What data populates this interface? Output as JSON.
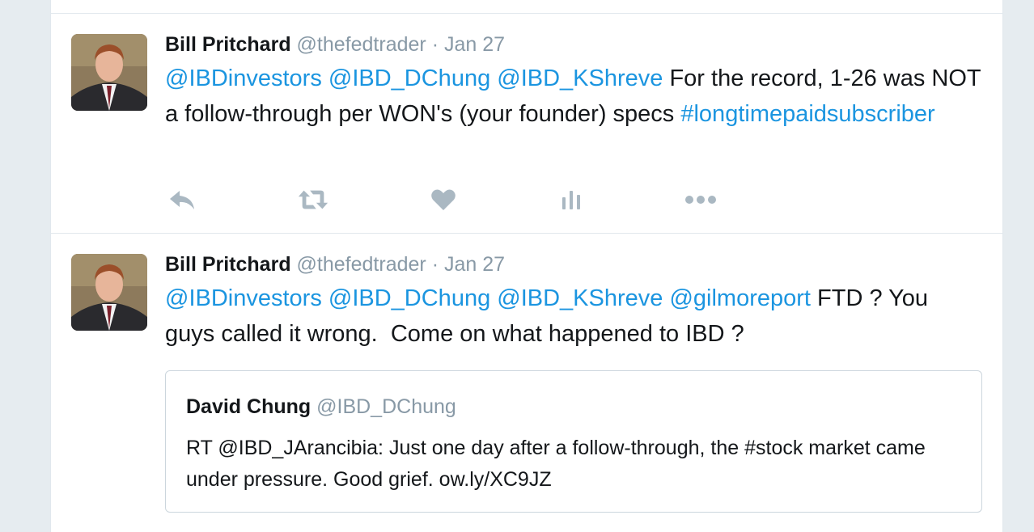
{
  "tweets": [
    {
      "author_name": "Bill Pritchard",
      "screen_name": "@thefedtrader",
      "separator": "·",
      "timestamp": "Jan 27",
      "text_parts": [
        {
          "text": "@IBDinvestors",
          "type": "mention"
        },
        {
          "text": " ",
          "type": "plain"
        },
        {
          "text": "@IBD_DChung",
          "type": "mention"
        },
        {
          "text": " ",
          "type": "plain"
        },
        {
          "text": "@IBD_KShreve",
          "type": "mention"
        },
        {
          "text": " For the record, 1-26 was NOT a follow-through per WON's (your founder) specs ",
          "type": "plain"
        },
        {
          "text": "#longtimepaidsubscriber",
          "type": "hashtag"
        }
      ],
      "actions": [
        "reply-icon",
        "retweet-icon",
        "like-icon",
        "analytics-icon",
        "more-icon"
      ]
    },
    {
      "author_name": "Bill Pritchard",
      "screen_name": "@thefedtrader",
      "separator": "·",
      "timestamp": "Jan 27",
      "text_parts": [
        {
          "text": "@IBDinvestors",
          "type": "mention"
        },
        {
          "text": " ",
          "type": "plain"
        },
        {
          "text": "@IBD_DChung",
          "type": "mention"
        },
        {
          "text": " ",
          "type": "plain"
        },
        {
          "text": "@IBD_KShreve",
          "type": "mention"
        },
        {
          "text": " ",
          "type": "plain"
        },
        {
          "text": "@gilmoreport",
          "type": "mention"
        },
        {
          "text": " FTD ? You guys called it wrong.  Come on what happened to IBD ?",
          "type": "plain"
        }
      ],
      "quoted": {
        "author_name": "David Chung",
        "screen_name": "@IBD_DChung",
        "text": "RT @IBD_JArancibia: Just one day after a follow-through, the #stock market came under pressure. Good grief. ow.ly/XC9JZ"
      }
    }
  ],
  "colors": {
    "link": "#1b95e0",
    "secondary_text": "#8899a6",
    "action_icon": "#aab8c2",
    "border": "#e1e8ed",
    "background": "#e6ecf0"
  }
}
